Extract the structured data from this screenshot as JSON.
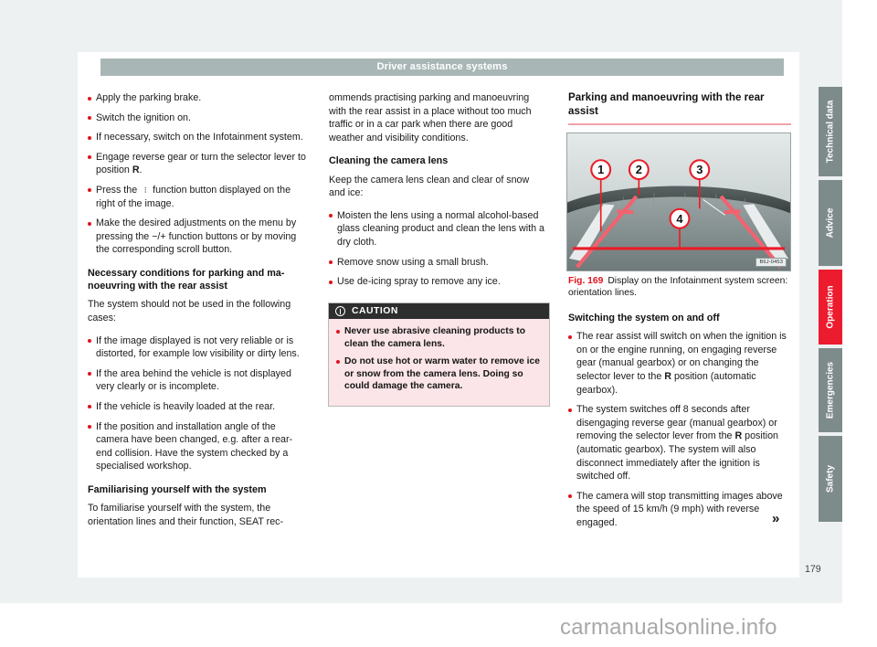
{
  "header": {
    "running_title": "Driver assistance systems"
  },
  "page": {
    "number": "179",
    "continuation_marker": "»"
  },
  "watermark": {
    "text": "carmanualsonline.info"
  },
  "column1": {
    "steps": [
      "Apply the parking brake.",
      "Switch the ignition on.",
      "If necessary, switch on the Infotainment system.",
      "Engage reverse gear or turn the selector lever to position R.",
      "Press the ⁙ function button displayed on the right of the image.",
      "Make the desired adjustments on the menu by pressing the −/+ function buttons or by moving the corresponding scroll button."
    ],
    "heading_conditions": "Necessary conditions for parking and ma-noeuvring with the rear assist",
    "conditions_intro": "The system should not be used in the following cases:",
    "conditions": [
      "If the image displayed is not very reliable or is distorted, for example low visibility or dirty lens.",
      "If the area behind the vehicle is not displayed very clearly or is incomplete.",
      "If the vehicle is heavily loaded at the rear.",
      "If the position and installation angle of the camera have been changed, e.g. after a rear-end collision. Have the system checked by a specialised workshop."
    ],
    "heading_familiarising": "Familiarising yourself with the system",
    "familiarising_text": "To familiarise yourself with the system, the orientation lines and their function, SEAT rec-"
  },
  "column2": {
    "continued_text": "ommends practising parking and manoeuvring with the rear assist in a place without too much traffic or in a car park when there are good weather and visibility conditions.",
    "heading_cleaning": "Cleaning the camera lens",
    "cleaning_intro": "Keep the camera lens clean and clear of snow and ice:",
    "cleaning_steps": [
      "Moisten the lens using a normal alcohol-based glass cleaning product and clean the lens with a dry cloth.",
      "Remove snow using a small brush.",
      "Use de-icing spray to remove any ice."
    ],
    "caution": {
      "title": "CAUTION",
      "items": [
        "Never use abrasive cleaning products to clean the camera lens.",
        "Do not use hot or warm water to remove ice or snow from the camera lens. Doing so could damage the camera."
      ]
    }
  },
  "column3": {
    "section_title": "Parking and manoeuvring with the rear assist",
    "figure": {
      "number": "Fig. 169",
      "caption": "Display on the Infotainment system screen: orientation lines.",
      "code": "B6J-0453",
      "callouts": [
        "1",
        "2",
        "3",
        "4"
      ]
    },
    "heading_switching": "Switching the system on and off",
    "switching_items": [
      "The rear assist will switch on when the ignition is on or the engine running, on engaging reverse gear (manual gearbox) or on changing the selector lever to the R position (automatic gearbox).",
      "The system switches off 8 seconds after disengaging reverse gear (manual gearbox) or removing the selector lever from the R position (automatic gearbox). The system will also disconnect immediately after the ignition is switched off.",
      "The camera will stop transmitting images above the speed of 15 km/h (9 mph) with reverse engaged."
    ]
  },
  "tabs": {
    "items": [
      {
        "label": "Technical data",
        "active": false
      },
      {
        "label": "Advice",
        "active": false
      },
      {
        "label": "Operation",
        "active": true
      },
      {
        "label": "Emergencies",
        "active": false
      },
      {
        "label": "Safety",
        "active": false
      }
    ],
    "active_color": "#ed1b2e",
    "inactive_color": "#7e8b8b"
  },
  "colors": {
    "header_bar": "#a9b6b6",
    "accent_red": "#e1121f",
    "caution_bg": "#fbe5e8",
    "caution_header": "#2e2e2e",
    "rule": "#f0a3ab"
  }
}
